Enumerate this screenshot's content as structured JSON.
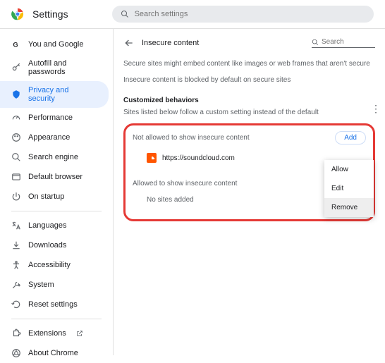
{
  "header": {
    "title": "Settings",
    "search_placeholder": "Search settings"
  },
  "sidebar": {
    "items": [
      {
        "label": "You and Google"
      },
      {
        "label": "Autofill and passwords"
      },
      {
        "label": "Privacy and security"
      },
      {
        "label": "Performance"
      },
      {
        "label": "Appearance"
      },
      {
        "label": "Search engine"
      },
      {
        "label": "Default browser"
      },
      {
        "label": "On startup"
      }
    ],
    "items2": [
      {
        "label": "Languages"
      },
      {
        "label": "Downloads"
      },
      {
        "label": "Accessibility"
      },
      {
        "label": "System"
      },
      {
        "label": "Reset settings"
      }
    ],
    "items3": [
      {
        "label": "Extensions"
      },
      {
        "label": "About Chrome"
      }
    ]
  },
  "page": {
    "title": "Insecure content",
    "search_placeholder": "Search",
    "desc1": "Secure sites might embed content like images or web frames that aren't secure",
    "desc2": "Insecure content is blocked by default on secure sites",
    "custom_heading": "Customized behaviors",
    "custom_sub": "Sites listed below follow a custom setting instead of the default",
    "not_allowed_label": "Not allowed to show insecure content",
    "add_label": "Add",
    "site1": "https://soundcloud.com",
    "allowed_label": "Allowed to show insecure content",
    "no_sites": "No sites added",
    "menu": {
      "allow": "Allow",
      "edit": "Edit",
      "remove": "Remove"
    }
  }
}
